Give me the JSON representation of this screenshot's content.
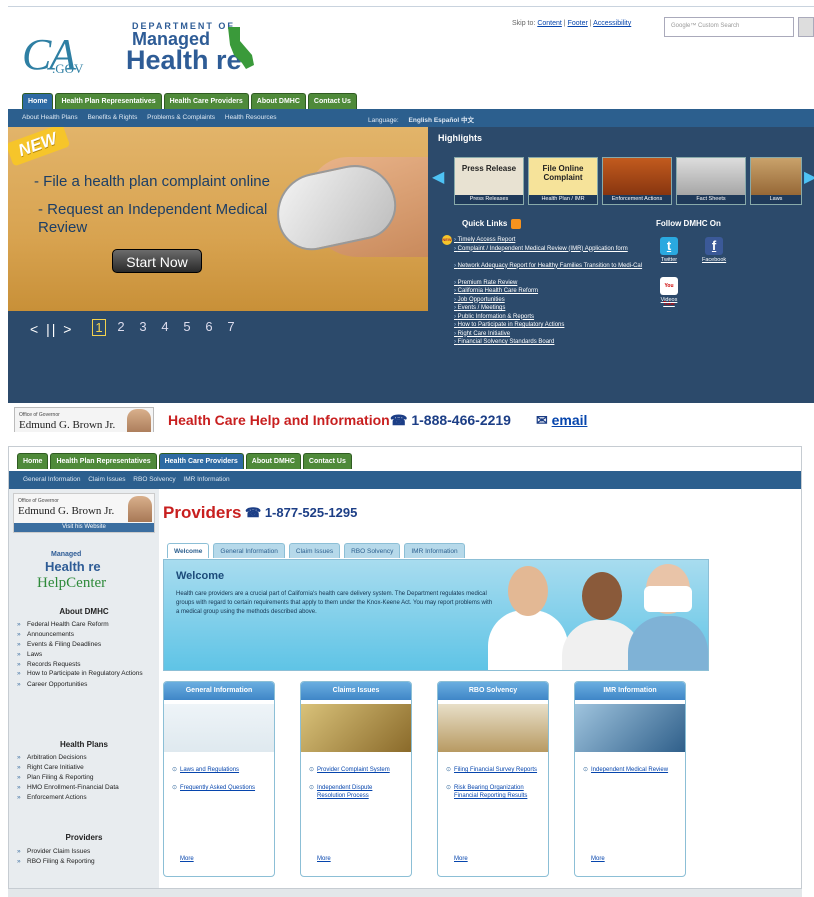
{
  "top": {
    "logo": {
      "ca": "CA",
      "gov": ".GOV",
      "dept": "DEPARTMENT OF",
      "managed": "Managed",
      "health": "Health  re",
      "care_c": "C"
    },
    "skip": {
      "label": "Skip to:",
      "links": [
        "Content",
        "Footer",
        "Accessibility"
      ]
    },
    "search": {
      "placeholder": "Google™ Custom Search"
    },
    "tabs": [
      "Home",
      "Health Plan Representatives",
      "Health Care Providers",
      "About DMHC",
      "Contact Us"
    ],
    "subnav": [
      "About Health Plans",
      "Benefits & Rights",
      "Problems & Complaints",
      "Health Resources"
    ],
    "language": {
      "label": "Language:",
      "options": [
        "English",
        "Español",
        "中文"
      ]
    },
    "hero": {
      "new": "NEW",
      "line1": "- File a health plan complaint online",
      "line2": "- Request an Independent Medical Review",
      "button": "Start Now"
    },
    "slider": {
      "controls": "<  ||  >",
      "pages": [
        "1",
        "2",
        "3",
        "4",
        "5",
        "6",
        "7"
      ]
    },
    "highlights": {
      "title": "Highlights",
      "items": [
        {
          "inner": "Press Release",
          "caption": "Press Releases"
        },
        {
          "inner": "File Online Complaint",
          "caption": "Health Plan / IMR"
        },
        {
          "inner": "",
          "caption": "Enforcement Actions"
        },
        {
          "inner": "",
          "caption": "Fact Sheets"
        },
        {
          "inner": "",
          "caption": "Laws"
        }
      ]
    },
    "quicklinks": {
      "title": "Quick Links",
      "items": [
        "Timely Access Report",
        "Complaint / Independent Medical Review (IMR) Application form",
        "Network Adequacy Report for Healthy Families Transition to Medi-Cal",
        "Premium Rate Review",
        "California Health Care Reform",
        "Job Opportunities",
        "Events / Meetings",
        "Public Information & Reports",
        "How to Participate in Regulatory Actions",
        "Right Care Initiative",
        "Financial Solvency Standards Board"
      ]
    },
    "follow": {
      "title": "Follow DMHC On",
      "twitter": "Twitter",
      "facebook": "Facebook",
      "youtube": "Videos",
      "yt_icon": "You Tube"
    },
    "help": {
      "gov_small": "Office of Governor",
      "gov_name": "Edmund G. Brown Jr.",
      "text": "Health Care Help and Information",
      "phone": "1-888-466-2219",
      "email": "email"
    }
  },
  "bottom": {
    "tabs": [
      "Home",
      "Health Plan Representatives",
      "Health Care Providers",
      "About DMHC",
      "Contact Us"
    ],
    "subnav": [
      "General Information",
      "Claim Issues",
      "RBO Solvency",
      "IMR Information"
    ],
    "sidebar": {
      "gov_small": "Office of Governor",
      "gov_name": "Edmund G. Brown Jr.",
      "visit": "Visit his Website",
      "logo": {
        "managed": "Managed",
        "health": "Health  re",
        "helpcenter": "HelpCenter"
      },
      "about_title": "About DMHC",
      "about_items": [
        "Federal Health Care Reform",
        "Announcements",
        "Events & Filing Deadlines",
        "Laws",
        "Records Requests",
        "How to Participate in Regulatory Actions",
        "Career Opportunities"
      ],
      "plans_title": "Health Plans",
      "plans_items": [
        "Arbitration Decisions",
        "Right Care Initiative",
        "Plan Filing & Reporting",
        "HMO Enrollment-Financial Data",
        "Enforcement Actions"
      ],
      "providers_title": "Providers",
      "providers_items": [
        "Provider Claim Issues",
        "RBO Filing & Reporting"
      ]
    },
    "main": {
      "title": "Providers",
      "phone": "1-877-525-1295",
      "tabs": [
        "Welcome",
        "General Information",
        "Claim Issues",
        "RBO Solvency",
        "IMR Information"
      ],
      "welcome_title": "Welcome",
      "welcome_text": "Health care providers are a crucial part of California's health care delivery system. The Department regulates medical groups with regard to certain requirements that apply to them under the Knox-Keene Act. You may report problems with a medical group using the methods described above.",
      "cards": [
        {
          "title": "General Information",
          "links": [
            "Laws and Regulations",
            "Frequently Asked Questions"
          ],
          "more": "More"
        },
        {
          "title": "Claims Issues",
          "links": [
            "Provider Complaint System",
            "Independent Dispute Resolution Process"
          ],
          "more": "More"
        },
        {
          "title": "RBO Solvency",
          "links": [
            "Filing Financial Survey Reports",
            "Risk Bearing Organization Financial Reporting Results"
          ],
          "more": "More"
        },
        {
          "title": "IMR Information",
          "links": [
            "Independent Medical Review"
          ],
          "more": "More"
        }
      ]
    }
  },
  "colors": {
    "nav_green": "#4f8a3a",
    "nav_blue": "#2c5f8e",
    "dark_panel": "#2c4a6b",
    "red_title": "#c81f1f",
    "link": "#0645ad"
  }
}
